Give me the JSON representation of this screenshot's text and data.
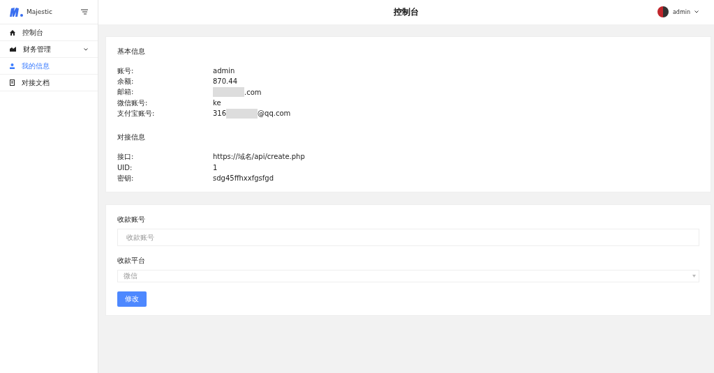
{
  "brand": {
    "name": "Majestic"
  },
  "sidebar": {
    "items": [
      {
        "label": "控制台",
        "kind": "link",
        "selected": false
      },
      {
        "label": "财务管理",
        "kind": "group",
        "selected": false
      },
      {
        "label": "我的信息",
        "kind": "link",
        "selected": true
      },
      {
        "label": "对接文档",
        "kind": "link",
        "selected": false
      }
    ]
  },
  "header": {
    "title": "控制台",
    "user": "admin"
  },
  "info_sections": [
    {
      "title": "基本信息",
      "rows": [
        {
          "label": "账号:",
          "value": [
            "admin"
          ]
        },
        {
          "label": "余额:",
          "value": [
            "870.44"
          ]
        },
        {
          "label": "邮箱:",
          "value": [
            {
              "kind": "hidden"
            },
            {
              "kind": "text",
              "text": ".com"
            }
          ]
        },
        {
          "label": "微信账号:",
          "value": [
            "ke"
          ]
        },
        {
          "label": "支付宝账号:",
          "value": [
            {
              "kind": "text",
              "text": "316"
            },
            {
              "kind": "hidden"
            },
            {
              "kind": "text",
              "text": "@qq.com"
            }
          ]
        }
      ]
    },
    {
      "title": "对接信息",
      "rows": [
        {
          "label": "接口:",
          "value": [
            "https://域名/api/create.php"
          ]
        },
        {
          "label": "UID:",
          "value": [
            "1"
          ]
        },
        {
          "label": "密钥:",
          "value": [
            "sdg45ffhxxfgsfgd"
          ]
        }
      ]
    }
  ],
  "form": {
    "account": {
      "label": "收款账号",
      "placeholder": "收款账号"
    },
    "platform": {
      "label": "收款平台",
      "value": "微信"
    },
    "submit": "修改"
  }
}
